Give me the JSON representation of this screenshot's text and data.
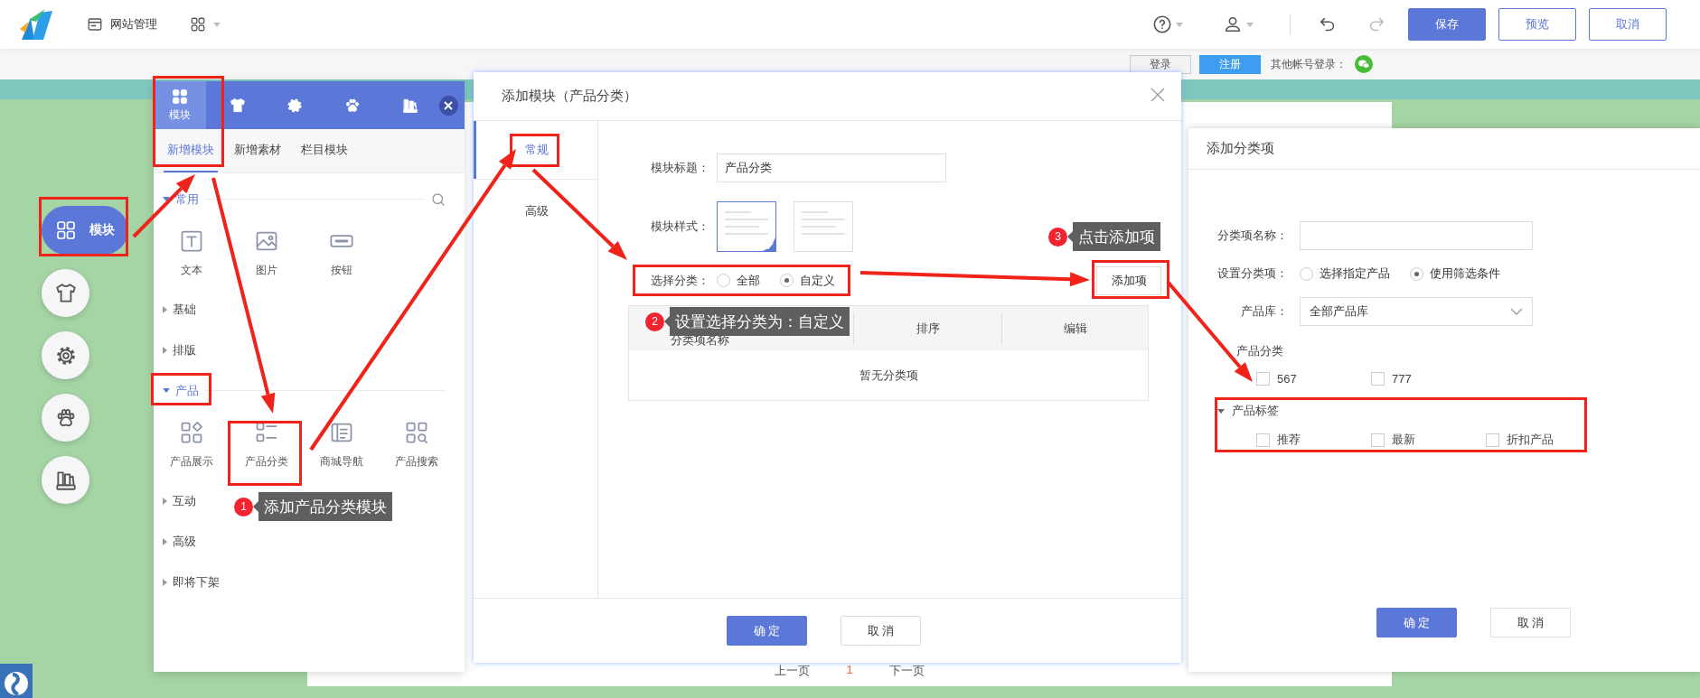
{
  "topbar": {
    "site_menu": "网站管理",
    "buttons": [
      {
        "label": "保存",
        "kind": "primary"
      },
      {
        "label": "预览",
        "kind": "outline"
      },
      {
        "label": "取消",
        "kind": "outline"
      }
    ]
  },
  "account_bar": {
    "buttons": [
      {
        "label": "登录",
        "selected": false
      },
      {
        "label": "注册",
        "selected": true
      }
    ],
    "other_login": "其他帐号登录："
  },
  "side_dock": {
    "items": [
      {
        "label": "模块",
        "selected": true
      },
      {
        "selected": false
      },
      {
        "selected": false
      },
      {
        "selected": false
      },
      {
        "selected": false
      }
    ]
  },
  "panel": {
    "tabs": [
      {
        "label": "模块",
        "selected": true
      },
      {
        "selected": false
      },
      {
        "selected": false
      },
      {
        "selected": false
      },
      {
        "selected": false
      }
    ],
    "subtabs": [
      {
        "label": "新增模块",
        "selected": true
      },
      {
        "label": "新增素材",
        "selected": false
      },
      {
        "label": "栏目模块",
        "selected": false
      }
    ],
    "sections": [
      {
        "title": "常用",
        "expanded": true,
        "items": [
          "文本",
          "图片",
          "按钮"
        ]
      },
      {
        "title": "基础",
        "expanded": false
      },
      {
        "title": "排版",
        "expanded": false
      },
      {
        "title": "产品",
        "expanded": true,
        "items": [
          "产品展示",
          "产品分类",
          "商城导航",
          "产品搜索"
        ]
      },
      {
        "title": "互动",
        "expanded": false
      },
      {
        "title": "高级",
        "expanded": false
      },
      {
        "title": "即将下架",
        "expanded": false
      }
    ]
  },
  "dialog": {
    "title": "添加模块（产品分类）",
    "tabs": [
      {
        "label": "常规",
        "selected": true
      },
      {
        "label": "高级",
        "selected": false
      }
    ],
    "title_label": "模块标题：",
    "title_value": "产品分类",
    "style_label": "模块样式：",
    "styles": [
      {
        "selected": true
      },
      {
        "selected": false
      }
    ],
    "category_label": "选择分类：",
    "options": [
      {
        "label": "全部",
        "selected": false
      },
      {
        "label": "自定义",
        "selected": true
      }
    ],
    "add_button": "添加项",
    "table": {
      "columns": [
        "分类项名称",
        "排序",
        "编辑"
      ],
      "empty": "暂无分类项"
    },
    "buttons": [
      "确 定",
      "取 消"
    ]
  },
  "item_dialog": {
    "title": "添加分类项",
    "name_label": "分类项名称：",
    "set_label": "设置分类项：",
    "options": [
      {
        "label": "选择指定产品",
        "selected": false
      },
      {
        "label": "使用筛选条件",
        "selected": true
      }
    ],
    "library_label": "产品库：",
    "library_value": "全部产品库",
    "groups": [
      {
        "title": "产品分类",
        "options": [
          {
            "label": "567",
            "checked": false
          },
          {
            "label": "777",
            "checked": false
          }
        ]
      },
      {
        "title": "产品标签",
        "expanded": true,
        "options": [
          {
            "label": "推荐",
            "checked": false
          },
          {
            "label": "最新",
            "checked": false
          },
          {
            "label": "折扣产品",
            "checked": false
          }
        ]
      }
    ],
    "buttons": [
      "确 定",
      "取 消"
    ]
  },
  "page": {
    "pager": [
      "上一页",
      "1",
      "下一页"
    ]
  },
  "annotations": {
    "callouts": [
      {
        "number": "1",
        "text": "添加产品分类模块"
      },
      {
        "number": "2",
        "text": "设置选择分类为：自定义"
      },
      {
        "number": "3",
        "text": "点击添加项"
      }
    ]
  }
}
